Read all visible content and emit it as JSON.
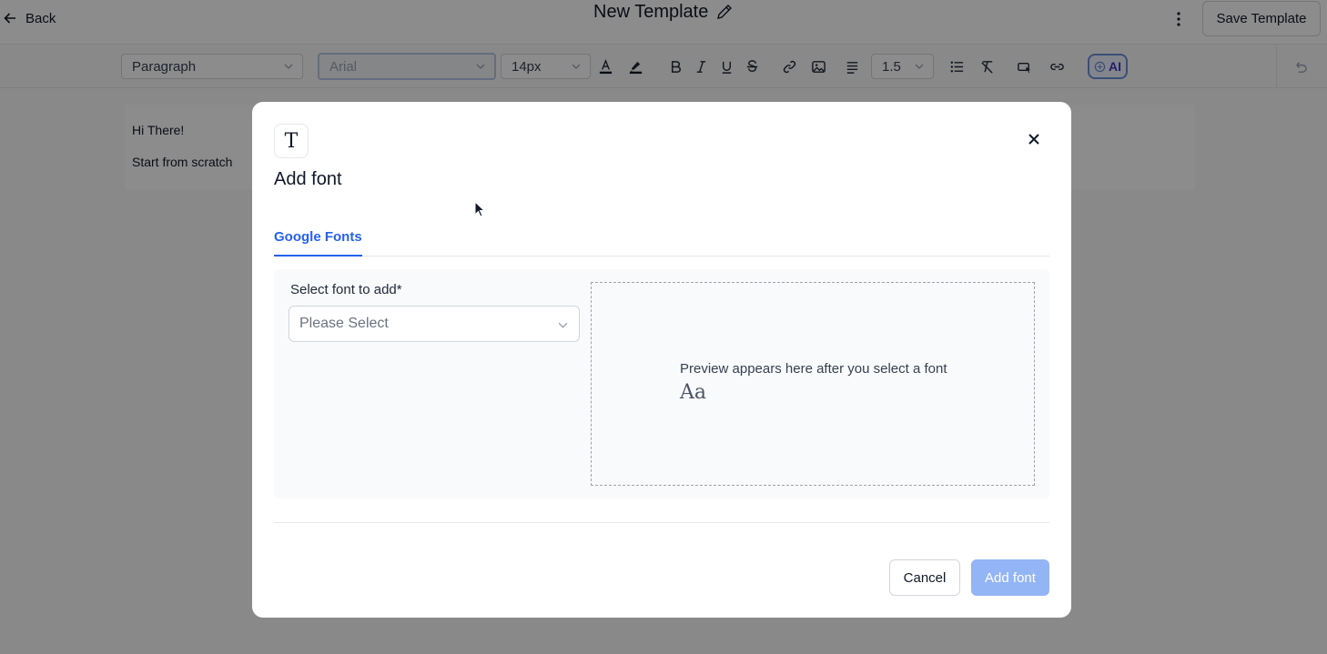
{
  "header": {
    "back_label": "Back",
    "title": "New Template",
    "save_label": "Save Template",
    "icons": [
      "arrow-left-icon",
      "pencil-icon",
      "kebab-menu-icon"
    ]
  },
  "toolbar": {
    "block_type": "Paragraph",
    "font_family": "Arial",
    "font_size": "14px",
    "line_height": "1.5",
    "ai_label": "AI",
    "icons": [
      "text-color-icon",
      "highlight-icon",
      "bold-icon",
      "italic-icon",
      "underline-icon",
      "strikethrough-icon",
      "link-icon",
      "image-icon",
      "align-icon",
      "bullet-list-icon",
      "clear-format-icon",
      "button-icon",
      "embed-link-icon",
      "ai-icon",
      "undo-icon"
    ]
  },
  "canvas": {
    "line1": "Hi There!",
    "line2": "Start from scratch"
  },
  "modal": {
    "icon": "T",
    "title": "Add font",
    "tab_label": "Google Fonts",
    "field_label": "Select font to add*",
    "select_placeholder": "Please Select",
    "preview_text": "Preview appears here after you select a font",
    "preview_sample": "Aa",
    "cancel_label": "Cancel",
    "add_label": "Add font"
  },
  "colors": {
    "accent": "#2563eb",
    "add_button_disabled": "#93b4f5",
    "overlay": "rgba(0,0,0,0.45)",
    "ai_accent": "#4338ca"
  }
}
